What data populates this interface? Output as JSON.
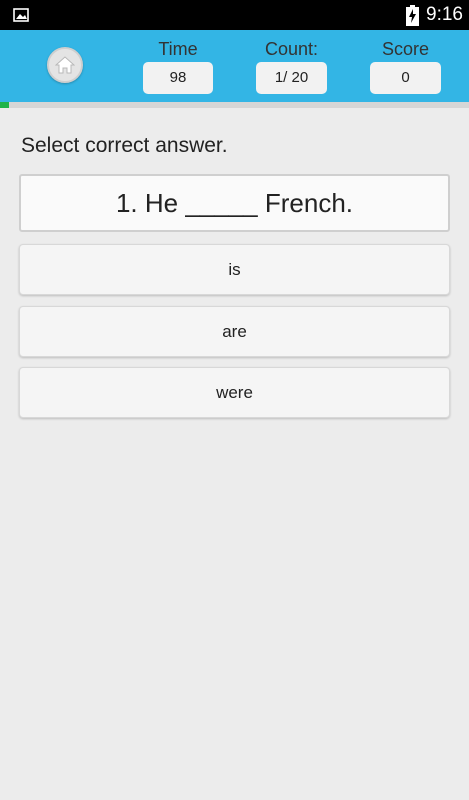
{
  "status_bar": {
    "time": "9:16",
    "notification_icon": "gallery-icon",
    "battery_icon": "battery-charging-icon"
  },
  "header": {
    "background": "#33b5e5",
    "home_icon": "home-icon",
    "time_label": "Time",
    "time_value": "98",
    "count_label": "Count:",
    "count_value": "1/ 20",
    "score_label": "Score",
    "score_value": "0"
  },
  "progress": {
    "fraction": 0.02,
    "color": "#1fb34a"
  },
  "quiz": {
    "instruction": "Select correct answer.",
    "question": "1. He _____ French.",
    "options": [
      "is",
      "are",
      "were"
    ]
  }
}
